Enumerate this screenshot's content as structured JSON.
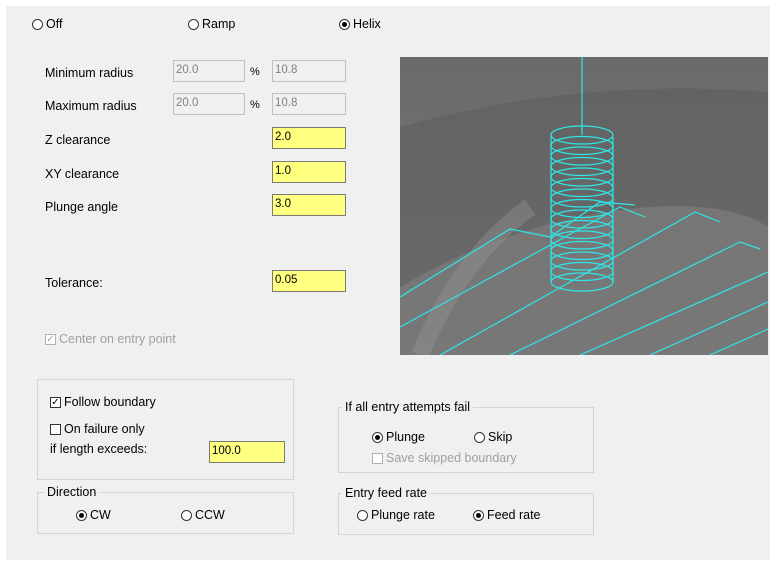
{
  "entry_mode": {
    "off_label": "Off",
    "ramp_label": "Ramp",
    "helix_label": "Helix",
    "selected": "Helix"
  },
  "params": {
    "min_radius": {
      "label": "Minimum radius",
      "percent": "20.0",
      "unit": "%",
      "value": "10.8"
    },
    "max_radius": {
      "label": "Maximum radius",
      "percent": "20.0",
      "unit": "%",
      "value": "10.8"
    },
    "z_clearance": {
      "label": "Z clearance",
      "value": "2.0"
    },
    "xy_clearance": {
      "label": "XY clearance",
      "value": "1.0"
    },
    "plunge_angle": {
      "label": "Plunge angle",
      "value": "3.0"
    },
    "tolerance": {
      "label": "Tolerance:",
      "value": "0.05"
    },
    "center_on_entry": {
      "label": "Center on entry point",
      "checked": true,
      "enabled": false
    }
  },
  "boundary": {
    "follow_label": "Follow boundary",
    "follow_checked": true,
    "failure_only_label": "On failure only",
    "failure_only_checked": false,
    "length_label": "if length exceeds:",
    "length_value": "100.0"
  },
  "direction": {
    "title": "Direction",
    "cw_label": "CW",
    "ccw_label": "CCW",
    "selected": "CW"
  },
  "entry_fail": {
    "title": "If all entry attempts fail",
    "plunge_label": "Plunge",
    "skip_label": "Skip",
    "selected": "Plunge",
    "save_skipped_label": "Save skipped boundary",
    "save_skipped_enabled": false
  },
  "entry_feed": {
    "title": "Entry feed rate",
    "plunge_rate_label": "Plunge rate",
    "feed_rate_label": "Feed rate",
    "selected": "Feed rate"
  },
  "colors": {
    "panel_bg": "#f0f0f0",
    "edit_field_bg": "#ffff80",
    "toolpath": "#2ee6e6",
    "preview_bg": "#6e6e6e"
  }
}
